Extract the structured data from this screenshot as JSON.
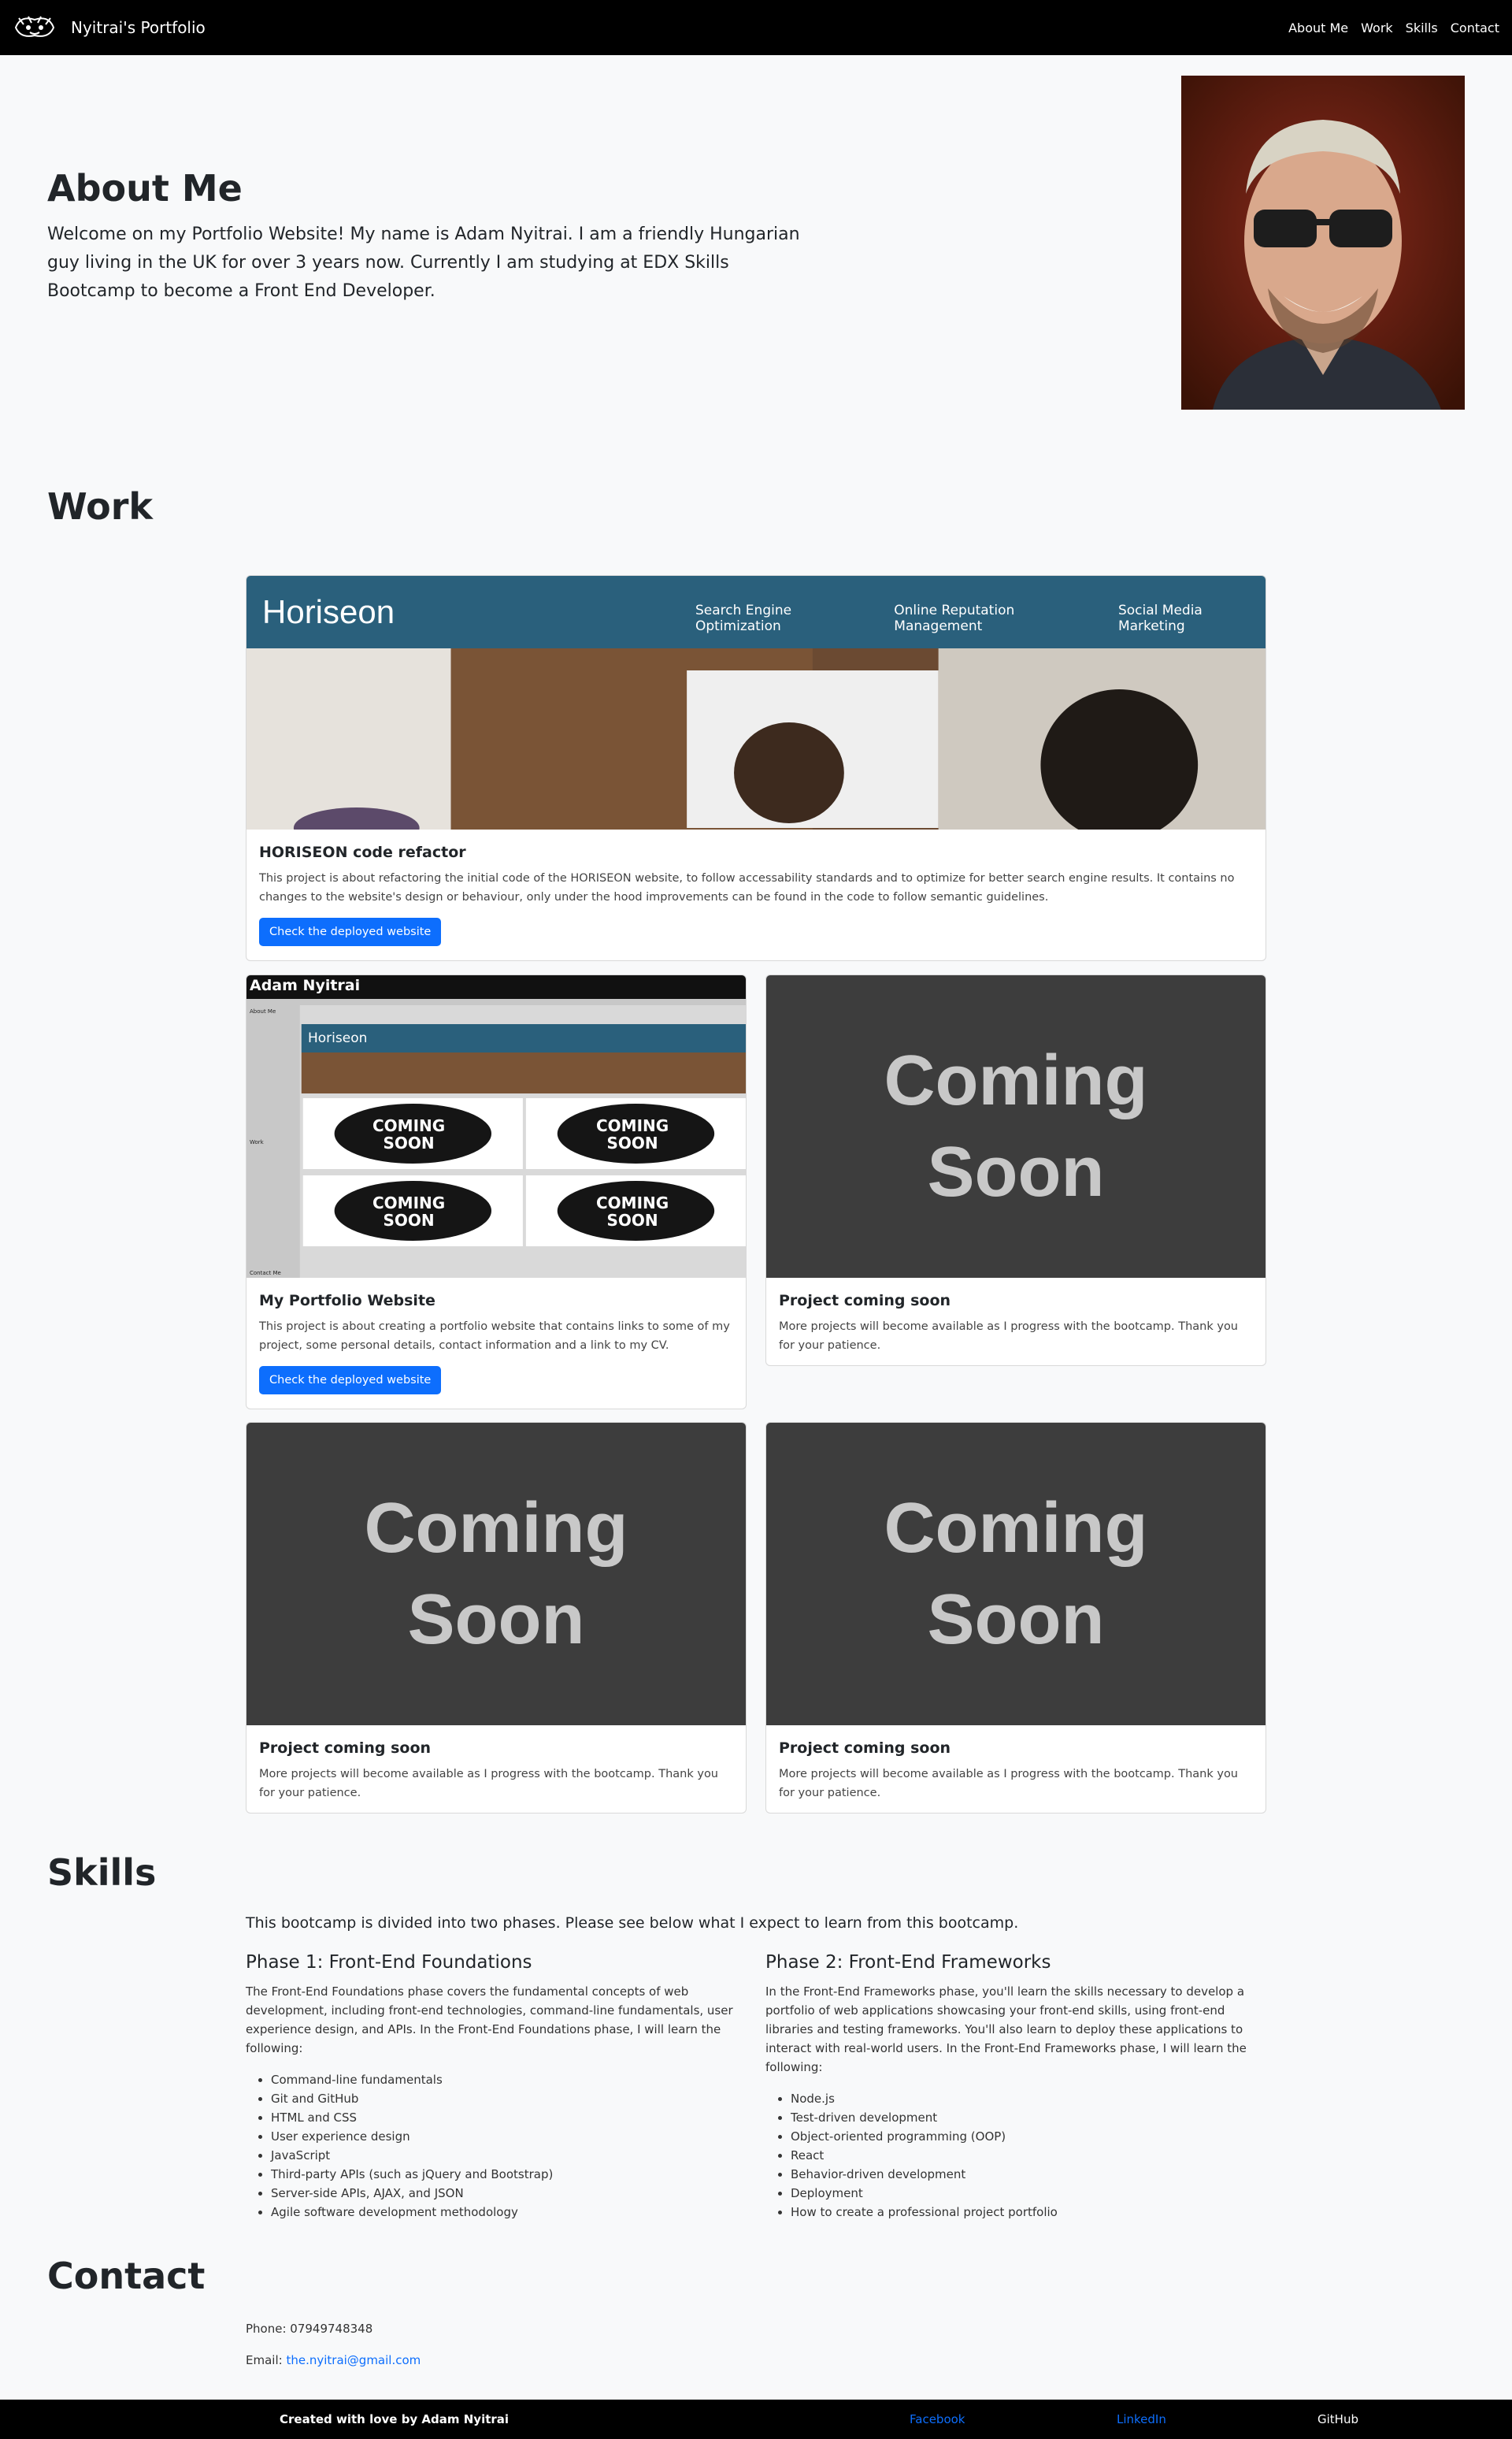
{
  "navbar": {
    "brand": "Nyitrai's Portfolio",
    "links": [
      "About Me",
      "Work",
      "Skills",
      "Contact"
    ]
  },
  "about": {
    "title": "About Me",
    "text": "Welcome on my Portfolio Website! My name is Adam Nyitrai. I am a friendly Hungarian guy living in the UK for over 3 years now. Currently I am studying at EDX Skills Bootcamp to become a Front End Developer."
  },
  "work": {
    "title": "Work",
    "horiseon": {
      "brand": "Horiseon",
      "nav": [
        "Search Engine Optimization",
        "Online Reputation Management",
        "Social Media Marketing"
      ]
    },
    "portfolio_preview": {
      "header": "Adam Nyitrai",
      "side_about": "About Me",
      "side_work": "Work",
      "side_contact": "Contact Me",
      "badge_line1": "COMING",
      "badge_line2": "SOON"
    },
    "coming_soon_line1": "Coming",
    "coming_soon_line2": "Soon",
    "cards": [
      {
        "title": "HORISEON code refactor",
        "text": "This project is about refactoring the initial code of the HORISEON website, to follow accessability standards and to optimize for better search engine results. It contains no changes to the website's design or behaviour, only under the hood improvements can be found in the code to follow semantic guidelines.",
        "button": "Check the deployed website"
      },
      {
        "title": "My Portfolio Website",
        "text": "This project is about creating a portfolio website that contains links to some of my project, some personal details, contact information and a link to my CV.",
        "button": "Check the deployed website"
      },
      {
        "title": "Project coming soon",
        "text": "More projects will become available as I progress with the bootcamp. Thank you for your patience."
      },
      {
        "title": "Project coming soon",
        "text": "More projects will become available as I progress with the bootcamp. Thank you for your patience."
      },
      {
        "title": "Project coming soon",
        "text": "More projects will become available as I progress with the bootcamp. Thank you for your patience."
      }
    ]
  },
  "skills": {
    "title": "Skills",
    "intro": "This bootcamp is divided into two phases. Please see below what I expect to learn from this bootcamp.",
    "phases": [
      {
        "title": "Phase 1: Front-End Foundations",
        "text": "The Front-End Foundations phase covers the fundamental concepts of web development, including front-end technologies, command-line fundamentals, user experience design, and APIs. In the Front-End Foundations phase, I will learn the following:",
        "items": [
          "Command-line fundamentals",
          "Git and GitHub",
          "HTML and CSS",
          "User experience design",
          "JavaScript",
          "Third-party APIs (such as jQuery and Bootstrap)",
          "Server-side APIs, AJAX, and JSON",
          "Agile software development methodology"
        ]
      },
      {
        "title": "Phase 2: Front-End Frameworks",
        "text": "In the Front-End Frameworks phase, you'll learn the skills necessary to develop a portfolio of web applications showcasing your front-end skills, using front-end libraries and testing frameworks. You'll also learn to deploy these applications to interact with real-world users. In the Front-End Frameworks phase, I will learn the following:",
        "items": [
          "Node.js",
          "Test-driven development",
          "Object-oriented programming (OOP)",
          "React",
          "Behavior-driven development",
          "Deployment",
          "How to create a professional project portfolio"
        ]
      }
    ]
  },
  "contact": {
    "title": "Contact",
    "phone": "Phone: 07949748348",
    "email_label": "Email:",
    "email": "the.nyitrai@gmail.com"
  },
  "footer": {
    "credit": "Created with love by Adam Nyitrai",
    "facebook": "Facebook",
    "linkedin": "LinkedIn",
    "github": "GitHub"
  },
  "colors": {
    "navbar": "#000000",
    "page_bg": "#f8f9fa",
    "primary_button": "#0d6efd",
    "horiseon_header": "#2a607c",
    "coming_soon_bg": "#3d3d3d"
  }
}
